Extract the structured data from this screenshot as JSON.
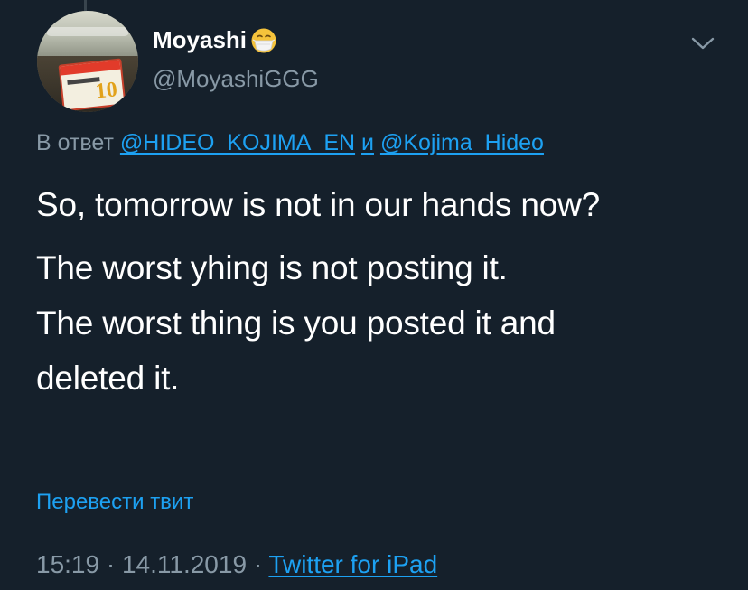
{
  "author": {
    "display_name": "Moyashi",
    "handle": "@MoyashiGGG",
    "name_emoji": "face-with-medical-mask-icon"
  },
  "reply": {
    "prefix": "В ответ",
    "mention_1": "@HIDEO_KOJIMA_EN",
    "conjunction": "и",
    "mention_2": "@Kojima_Hideo"
  },
  "tweet": {
    "lines_para1": [
      "So, tomorrow is not in our hands now?"
    ],
    "lines_para2": [
      "The worst yhing is not posting it.",
      "The worst thing is you posted it and",
      "deleted it."
    ]
  },
  "translate_label": "Перевести твит",
  "meta": {
    "time": "15:19",
    "separator": "·",
    "date": "14.11.2019",
    "source": "Twitter for iPad"
  },
  "icons": {
    "more": "chevron-down-icon"
  },
  "colors": {
    "background": "#15202b",
    "accent": "#1da1f2",
    "secondary_text": "#8899a6",
    "primary_text": "#ffffff"
  }
}
